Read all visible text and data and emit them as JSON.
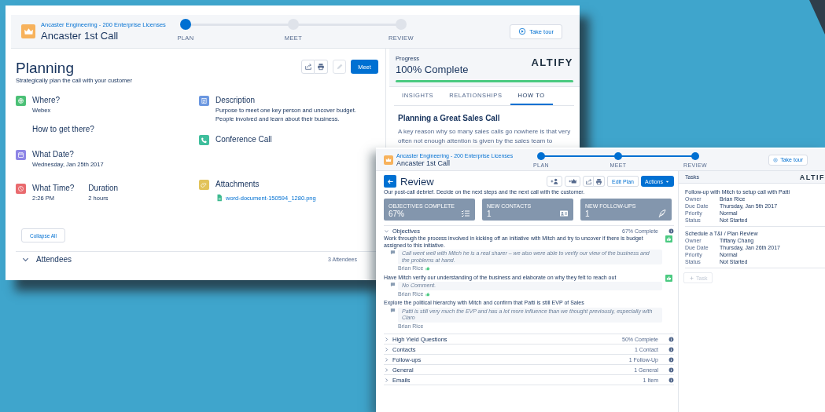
{
  "planning_window": {
    "header": {
      "account": "Ancaster Engineering - 200 Enterprise Licenses",
      "title": "Ancaster 1st Call",
      "tour_button": "Take tour"
    },
    "steps": [
      {
        "label": "PLAN",
        "reached": true
      },
      {
        "label": "MEET",
        "reached": false
      },
      {
        "label": "REVIEW",
        "reached": false
      }
    ],
    "title": "Planning",
    "subtitle": "Strategically plan the call with your customer",
    "primary_button": "Meet",
    "fields_left": [
      {
        "kind": "location",
        "color": "#4bc076",
        "label": "Where?",
        "value": "Webex",
        "link": "How to get there?"
      },
      {
        "kind": "date",
        "color": "#8d85e6",
        "label": "What Date?",
        "value": "Wednesday, Jan 25th 2017"
      },
      {
        "kind": "time",
        "color": "#e96a6e",
        "label": "What Time?",
        "value": "2:26 PM",
        "second_label": "Duration",
        "second_value": "2 hours"
      }
    ],
    "fields_right": [
      {
        "kind": "description",
        "color": "#6b97e0",
        "label": "Description",
        "lines": [
          "Purpose to meet one key person and uncover budget.",
          "People involved and learn about their business."
        ]
      },
      {
        "kind": "call",
        "color": "#3fbe9c",
        "label": "Conference Call"
      },
      {
        "kind": "attachment",
        "color": "#e2c35a",
        "label": "Attachments",
        "file": "word-document-150594_1280.png"
      }
    ],
    "collapse_button": "Collapse All",
    "attendees": {
      "label": "Attendees",
      "expanded": true,
      "count": "3 Attendees"
    },
    "progress": {
      "label": "Progress",
      "value": "100% Complete",
      "level": 1
    },
    "logo": "ALTIFY",
    "tabs": [
      {
        "label": "INSIGHTS",
        "selected": false
      },
      {
        "label": "RELATIONSHIPS",
        "selected": false
      },
      {
        "label": "HOW TO",
        "selected": true
      }
    ],
    "article": {
      "title": "Planning a Great Sales Call",
      "text": "A key reason why so many sales calls go nowhere is that very often not enough attention is given by the sales team to"
    }
  },
  "review_window": {
    "header": {
      "account": "Ancaster Engineering - 200 Enterprise Licenses",
      "title": "Ancaster 1st Call",
      "tour_button": "Take tour"
    },
    "steps": [
      {
        "label": "PLAN",
        "reached": true
      },
      {
        "label": "MEET",
        "reached": true
      },
      {
        "label": "REVIEW",
        "reached": true
      }
    ],
    "title": "Review",
    "subtitle": "Our post-call debrief. Decide on the next steps and the next call with the customer.",
    "edit_button": "Edit Plan",
    "actions_button": "Actions",
    "stats": [
      {
        "kind": "objectives",
        "label": "OBJECTIVES COMPLETE",
        "value": "67%"
      },
      {
        "kind": "contacts",
        "label": "NEW CONTACTS",
        "value": "1"
      },
      {
        "kind": "followups",
        "label": "NEW FOLLOW-UPS",
        "value": "1"
      }
    ],
    "sections": [
      {
        "label": "Objectives",
        "status": "67% Complete",
        "expanded": true,
        "items": [
          {
            "text": "Work through the process involved in kicking off an initiative with Mitch and try to uncover if there is budget assigned to this initiative.",
            "comment": "Call went well with Mitch he is a real sharer – we also were able to verify our view of the business and the problems at hand.",
            "author": "Brian Rice",
            "liked": true
          },
          {
            "text": "Have Mitch verify our understanding of the business and elaborate on why they felt to reach out",
            "comment": "No Comment.",
            "author": "Brian Rice",
            "liked": true
          },
          {
            "text": "Explore the political hierarchy with Mitch and confirm that Patti is still EVP of Sales",
            "comment": "Patti is still very much the EVP and has a lot more influence than we thought previously, especially with Claro",
            "author": "Brian Rice",
            "liked": false
          }
        ]
      },
      {
        "label": "High Yield Questions",
        "status": "50% Complete",
        "expanded": false
      },
      {
        "label": "Contacts",
        "status": "1 Contact",
        "expanded": false
      },
      {
        "label": "Follow-ups",
        "status": "1 Follow-Up",
        "expanded": false
      },
      {
        "label": "General",
        "status": "1 General",
        "expanded": false
      },
      {
        "label": "Emails",
        "status": "1 Item",
        "expanded": false
      }
    ],
    "tasks_panel": {
      "title": "Tasks",
      "logo": "ALTIF",
      "tasks": [
        {
          "title": "Follow-up with Mitch to setup call with Patti",
          "fields": [
            {
              "label": "Owner",
              "value": "Brian Rice"
            },
            {
              "label": "Due Date",
              "value": "Thursday, Jan 5th 2017"
            },
            {
              "label": "Priority",
              "value": "Normal"
            },
            {
              "label": "Status",
              "value": "Not Started"
            }
          ]
        },
        {
          "title": "Schedule a T&I / Plan Review",
          "fields": [
            {
              "label": "Owner",
              "value": "Tiffany Chang"
            },
            {
              "label": "Due Date",
              "value": "Thursday, Jan 26th 2017"
            },
            {
              "label": "Priority",
              "value": "Normal"
            },
            {
              "label": "Status",
              "value": "Not Started"
            }
          ]
        }
      ],
      "add_button": {
        "label": "Task",
        "disabled": true
      }
    }
  }
}
